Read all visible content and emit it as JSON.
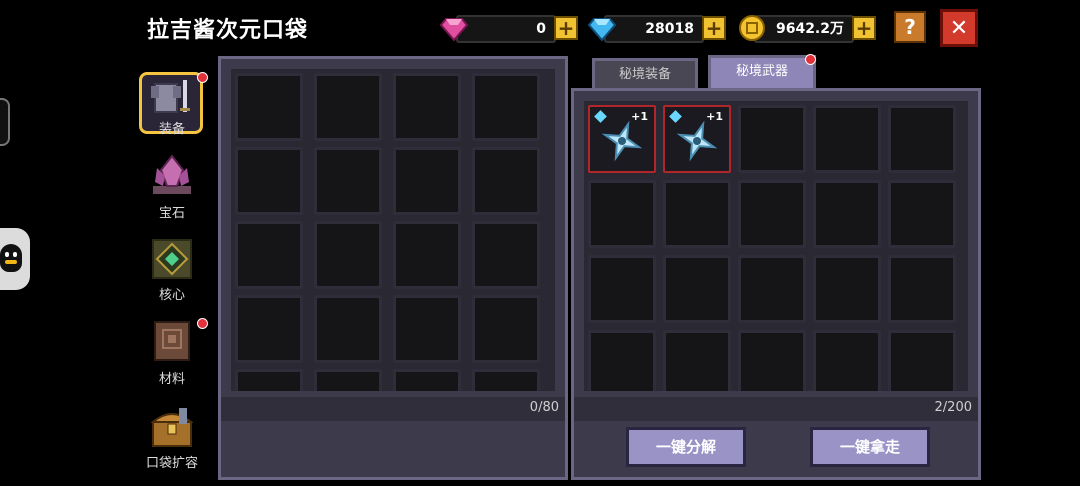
{
  "title": "拉吉酱次元口袋",
  "currency": {
    "pink_gem": {
      "value": "0",
      "icon": "pink-gem-icon",
      "color": "#e14fa1"
    },
    "blue_gem": {
      "value": "28018",
      "icon": "blue-diamond-icon",
      "color": "#43b8f0"
    },
    "gold": {
      "value": "9642.2万",
      "icon": "gold-coin-icon",
      "color": "#f4c430"
    },
    "plus_label": "+"
  },
  "help_label": "?",
  "close_label": "✕",
  "side_nav": [
    {
      "label": "装备",
      "icon": "armor-icon",
      "selected": true,
      "red_dot": true
    },
    {
      "label": "宝石",
      "icon": "gem-crystal-icon",
      "selected": false,
      "red_dot": false
    },
    {
      "label": "核心",
      "icon": "core-icon",
      "selected": false,
      "red_dot": false
    },
    {
      "label": "材料",
      "icon": "material-book-icon",
      "selected": false,
      "red_dot": true
    },
    {
      "label": "口袋扩容",
      "icon": "treasure-chest-icon",
      "selected": false,
      "red_dot": false
    }
  ],
  "left_panel": {
    "count": "0/80"
  },
  "tabs": [
    {
      "label": "秘境装备",
      "active": false,
      "red_dot": false
    },
    {
      "label": "秘境武器",
      "active": true,
      "red_dot": true
    }
  ],
  "right_panel": {
    "count": "2/200",
    "items": [
      {
        "icon": "shuriken-icon",
        "level": "+1"
      },
      {
        "icon": "shuriken-icon",
        "level": "+1"
      }
    ]
  },
  "buttons": {
    "decompose": "一键分解",
    "take_all": "一键拿走"
  }
}
